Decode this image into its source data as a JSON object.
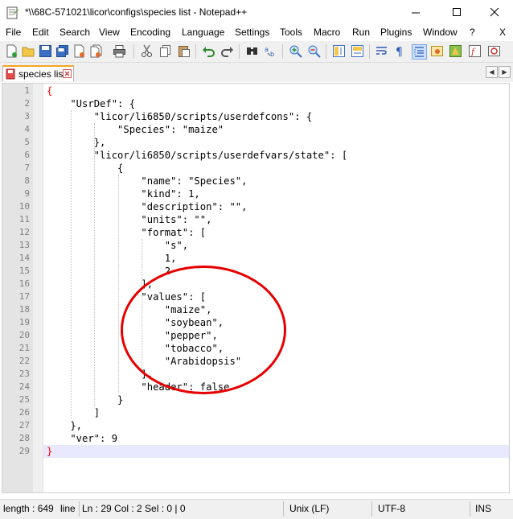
{
  "window": {
    "title": "*\\\\68C-571021\\licor\\configs\\species list - Notepad++",
    "minimize_glyph": "—",
    "maximize_glyph": "☐",
    "close_glyph": "✕",
    "doc_close_glyph": "X"
  },
  "menu": [
    "File",
    "Edit",
    "Search",
    "View",
    "Encoding",
    "Language",
    "Settings",
    "Tools",
    "Macro",
    "Run",
    "Plugins",
    "Window",
    "?"
  ],
  "toolbar": {
    "icons": [
      "new-file-icon",
      "open-file-icon",
      "save-icon",
      "save-all-icon",
      "close-icon",
      "close-all-icon",
      "print-icon",
      "cut-icon",
      "copy-icon",
      "paste-icon",
      "undo-icon",
      "redo-icon",
      "find-icon",
      "replace-icon",
      "zoom-in-icon",
      "zoom-out-icon",
      "sync-v-icon",
      "sync-h-icon",
      "word-wrap-icon",
      "show-all-chars-icon",
      "indent-guide-icon",
      "udl-icon",
      "doc-map-icon",
      "function-list-icon",
      "folder-workspace-icon"
    ]
  },
  "tabs": [
    {
      "label": "species list",
      "active": true,
      "modified": true
    }
  ],
  "tab_nav": {
    "left": "◀",
    "right": "▶"
  },
  "editor": {
    "current_line": 29,
    "lines": [
      "{",
      "    \"UsrDef\": {",
      "        \"licor/li6850/scripts/userdefcons\": {",
      "            \"Species\": \"maize\"",
      "        },",
      "        \"licor/li6850/scripts/userdefvars/state\": [",
      "            {",
      "                \"name\": \"Species\",",
      "                \"kind\": 1,",
      "                \"description\": \"\",",
      "                \"units\": \"\",",
      "                \"format\": [",
      "                    \"s\",",
      "                    1,",
      "                    2",
      "                ],",
      "                \"values\": [",
      "                    \"maize\",",
      "                    \"soybean\",",
      "                    \"pepper\",",
      "                    \"tobacco\",",
      "                    \"Arabidopsis\"",
      "                ],",
      "                \"header\": false",
      "            }",
      "        ]",
      "    },",
      "    \"ver\": 9",
      "}"
    ]
  },
  "status": {
    "length": "length : 649",
    "lines_label": "line",
    "position": "Ln : 29    Col : 2    Sel : 0 | 0",
    "eol": "Unix (LF)",
    "encoding": "UTF-8",
    "mode": "INS"
  },
  "colors": {
    "annotation": "#e60000",
    "brace": "#ff0000",
    "current_line": "#e8e8ff",
    "tab_accent": "#f5a623"
  }
}
